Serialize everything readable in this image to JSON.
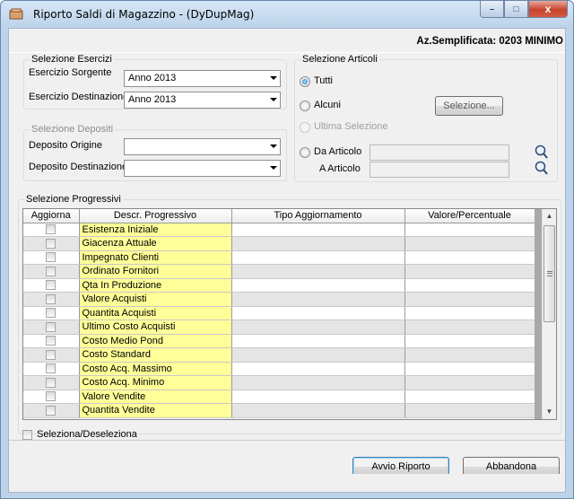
{
  "window": {
    "title": "Riporto Saldi di Magazzino - (DyDupMag)",
    "company": "Az.Semplificata: 0203 MINIMO",
    "controls": {
      "minimize": "–",
      "maximize": "□",
      "close": "x"
    }
  },
  "esercizi": {
    "title": "Selezione Esercizi",
    "sorgente_label": "Esercizio Sorgente",
    "sorgente_value": "Anno 2013",
    "destinazione_label": "Esercizio Destinazione",
    "destinazione_value": "Anno 2013"
  },
  "depositi": {
    "title": "Selezione Depositi",
    "origine_label": "Deposito Origine",
    "origine_value": "",
    "destinazione_label": "Deposito Destinazione",
    "destinazione_value": ""
  },
  "articoli": {
    "title": "Selezione Articoli",
    "tutti_label": "Tutti",
    "tutti_checked": true,
    "alcuni_label": "Alcuni",
    "selezione_button": "Selezione...",
    "ultima_label": "Ultima Selezione",
    "da_articolo_label": "Da Articolo",
    "a_articolo_label": "A Articolo",
    "da_articolo_value": "",
    "a_articolo_value": ""
  },
  "progressivi": {
    "title": "Selezione Progressivi",
    "columns": [
      "Aggiorna",
      "Descr. Progressivo",
      "Tipo Aggiornamento",
      "Valore/Percentuale"
    ],
    "rows": [
      {
        "descr": "Esistenza Iniziale",
        "tipo": "",
        "valore": "",
        "aggiorna": false
      },
      {
        "descr": "Giacenza Attuale",
        "tipo": "",
        "valore": "",
        "aggiorna": false
      },
      {
        "descr": "Impegnato Clienti",
        "tipo": "",
        "valore": "",
        "aggiorna": false
      },
      {
        "descr": "Ordinato Fornitori",
        "tipo": "",
        "valore": "",
        "aggiorna": false
      },
      {
        "descr": "Qta In Produzione",
        "tipo": "",
        "valore": "",
        "aggiorna": false
      },
      {
        "descr": "Valore Acquisti",
        "tipo": "",
        "valore": "",
        "aggiorna": false
      },
      {
        "descr": "Quantita Acquisti",
        "tipo": "",
        "valore": "",
        "aggiorna": false
      },
      {
        "descr": "Ultimo Costo Acquisti",
        "tipo": "",
        "valore": "",
        "aggiorna": false
      },
      {
        "descr": "Costo Medio Pond",
        "tipo": "",
        "valore": "",
        "aggiorna": false
      },
      {
        "descr": "Costo Standard",
        "tipo": "",
        "valore": "",
        "aggiorna": false
      },
      {
        "descr": "Costo Acq. Massimo",
        "tipo": "",
        "valore": "",
        "aggiorna": false
      },
      {
        "descr": "Costo Acq. Minimo",
        "tipo": "",
        "valore": "",
        "aggiorna": false
      },
      {
        "descr": "Valore Vendite",
        "tipo": "",
        "valore": "",
        "aggiorna": false
      },
      {
        "descr": "Quantita Vendite",
        "tipo": "",
        "valore": "",
        "aggiorna": false
      }
    ],
    "seleziona_label": "Seleziona/Deseleziona",
    "scroll": {
      "up": "▲",
      "down": "▼"
    }
  },
  "actions": {
    "avvio_label": "Avvio Riporto",
    "abbandona_label": "Abbandona"
  },
  "colors": {
    "highlight_cell": "#ffff99",
    "title_bg": "#bcd3ea"
  }
}
